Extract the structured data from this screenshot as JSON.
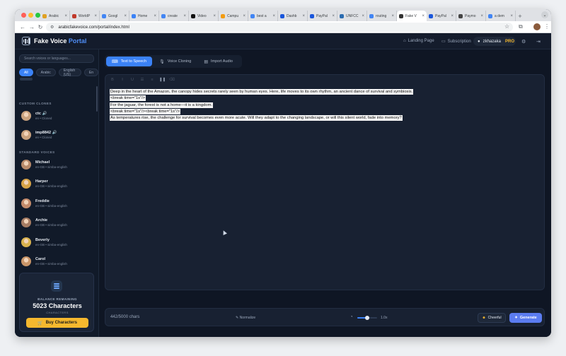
{
  "browser": {
    "tabs": [
      {
        "label": "Arabic",
        "color": "#e0a022"
      },
      {
        "label": "WorldP",
        "color": "#c0392b"
      },
      {
        "label": "Googl",
        "color": "#4285f4"
      },
      {
        "label": "Home",
        "color": "#3b82f6"
      },
      {
        "label": "create",
        "color": "#4285f4"
      },
      {
        "label": "Video",
        "color": "#111111"
      },
      {
        "label": "Campu",
        "color": "#f39c12"
      },
      {
        "label": "best a",
        "color": "#4285f4"
      },
      {
        "label": "Dashb",
        "color": "#1a56db"
      },
      {
        "label": "PayPal",
        "color": "#1a56db"
      },
      {
        "label": "UNFCC",
        "color": "#2b6cb0"
      },
      {
        "label": "routing",
        "color": "#4285f4"
      },
      {
        "label": "Fake V",
        "color": "#333333",
        "active": true
      },
      {
        "label": "PayPal",
        "color": "#1a56db"
      },
      {
        "label": "Paymo",
        "color": "#444444"
      },
      {
        "label": "a dem",
        "color": "#4285f4"
      }
    ],
    "close_glyph": "×",
    "new_tab_glyph": "+",
    "url": "arabicfakevoice.com/portal/index.html"
  },
  "header": {
    "brand_main": "Fake Voice",
    "brand_accent": "Portal",
    "landing_label": "Landing Page",
    "subscription_label": "Subscription",
    "username": "zkhazaka",
    "plan": "PRO"
  },
  "sidebar": {
    "search_placeholder": "Search voices or languages...",
    "filters": [
      "All",
      "Arabic",
      "English (US)",
      "En"
    ],
    "custom_heading": "CUSTOM CLONES",
    "custom_voices": [
      {
        "name": "ctc 🔊",
        "meta": "en • Cloned",
        "color": "#c9a27e"
      },
      {
        "name": "imp8842 🔊",
        "meta": "en • Cloned",
        "color": "#c9a27e"
      }
    ],
    "standard_heading": "STANDARD VOICES",
    "standard_voices": [
      {
        "name": "Michael",
        "meta": "en-GB • simba-english",
        "color": "#b98a6a"
      },
      {
        "name": "Harper",
        "meta": "en-GB • simba-english",
        "color": "#d7a347"
      },
      {
        "name": "Freddie",
        "meta": "en-GB • simba-english",
        "color": "#c48b6b"
      },
      {
        "name": "Archie",
        "meta": "en-GB • simba-english",
        "color": "#a67c63"
      },
      {
        "name": "Beverly",
        "meta": "en-GB • simba-english",
        "color": "#d9b24e"
      },
      {
        "name": "Carol",
        "meta": "en-GB • simba-english",
        "color": "#c99568"
      }
    ],
    "balance": {
      "label": "BALANCE REMAINING",
      "value": "5023 Characters",
      "unit": "CHARACTERS",
      "buy_label": "Buy Characters"
    }
  },
  "main": {
    "modes": [
      {
        "label": "Text to Speech",
        "active": true
      },
      {
        "label": "Voice Cloning",
        "active": false
      },
      {
        "label": "Import Audio",
        "active": false
      }
    ],
    "editor_lines": [
      "Deep in the heart of the Amazon, the canopy hides secrets rarely seen by human eyes. Here, life moves to its own rhythm, an ancient dance of survival and symbiosis.",
      "<break time=\"1s\"/>",
      "For the jaguar, the forest is not a home—it is a kingdom.",
      "<break time=\"1s\"/><break time=\"1s\"/>",
      "As temperatures rise, the challenge for survival becomes even more acute. Will they adapt to the changing landscape, or will this silent world, fade into memory?"
    ],
    "char_count": "442/5000 chars",
    "normalize_label": "Normalize",
    "speed_value": "1.0x",
    "speed_fraction": 0.5,
    "mood_label": "Cheerful",
    "generate_label": "Generate"
  }
}
